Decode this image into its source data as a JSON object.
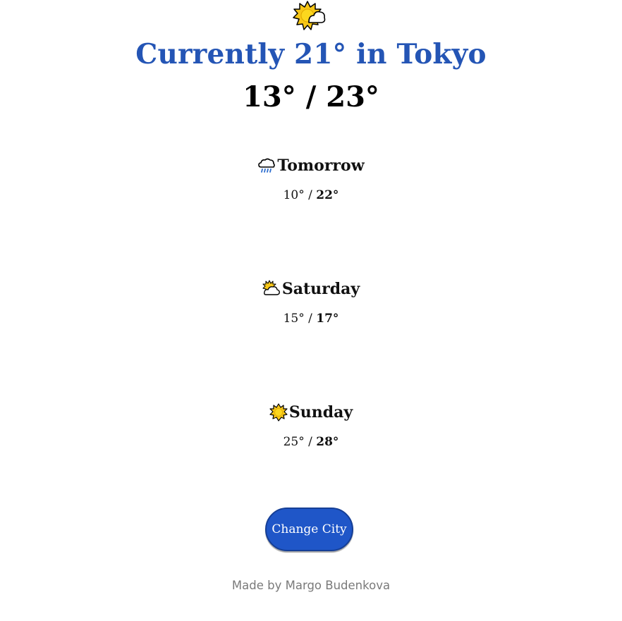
{
  "current": {
    "icon": "sun-behind-cloud-icon",
    "title": "Currently 21° in Tokyo",
    "low": "13°",
    "separator": " / ",
    "high": "23°"
  },
  "forecast": [
    {
      "icon": "rain-cloud-icon",
      "day": "Tomorrow",
      "low": "10°",
      "separator": " / ",
      "high": "22°"
    },
    {
      "icon": "sun-behind-cloud-icon",
      "day": "Saturday",
      "low": "15°",
      "separator": " / ",
      "high": "17°"
    },
    {
      "icon": "sun-icon",
      "day": "Sunday",
      "low": "25°",
      "separator": " / ",
      "high": "28°"
    }
  ],
  "button": {
    "label": "Change City"
  },
  "footer": {
    "text": "Made by Margo Budenkova"
  },
  "colors": {
    "title": "#2455b5",
    "button": "#1f56c8",
    "footer": "#7a7a7a",
    "sun": "#f7c718",
    "sun_outline": "#000000"
  }
}
